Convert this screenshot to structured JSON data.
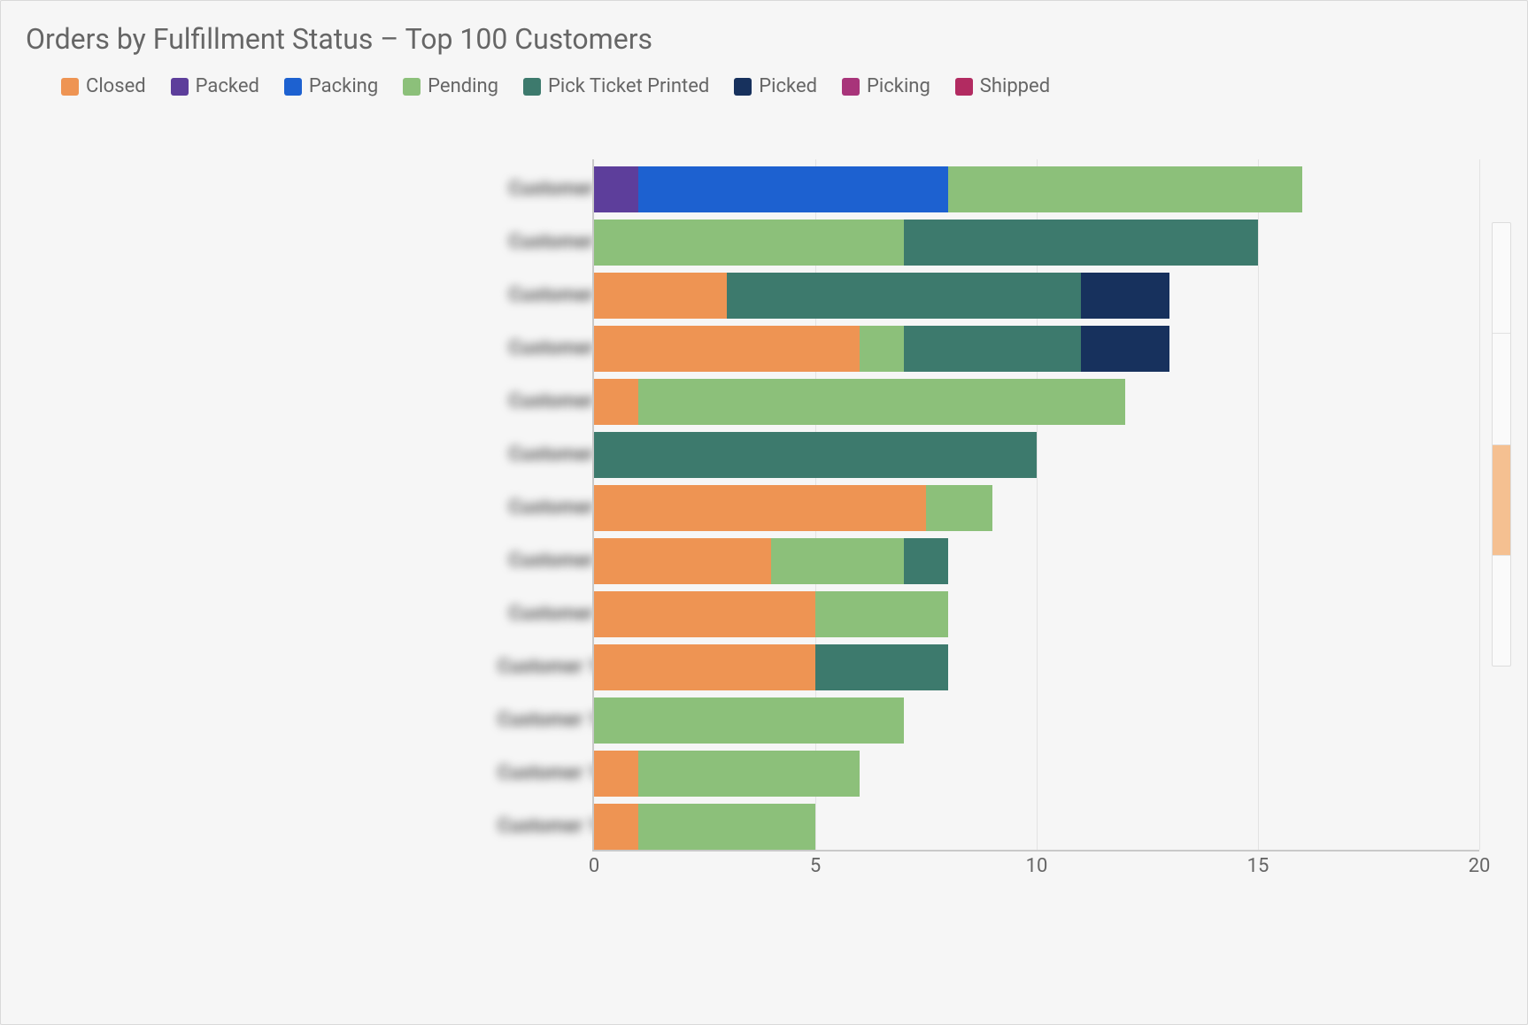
{
  "title": "Orders by Fulfillment Status – Top 100 Customers",
  "legend": [
    {
      "name": "Closed",
      "color": "#ee9453"
    },
    {
      "name": "Packed",
      "color": "#5d3e9b"
    },
    {
      "name": "Packing",
      "color": "#1d61d0"
    },
    {
      "name": "Pending",
      "color": "#8cc07a"
    },
    {
      "name": "Pick Ticket Printed",
      "color": "#3d7a6d"
    },
    {
      "name": "Picked",
      "color": "#17315d"
    },
    {
      "name": "Picking",
      "color": "#a8347a"
    },
    {
      "name": "Shipped",
      "color": "#b22b61"
    }
  ],
  "xticks": [
    "0",
    "5",
    "10",
    "15",
    "20"
  ],
  "x_max": 20,
  "chart_data": {
    "type": "bar",
    "title": "Orders by Fulfillment Status – Top 100 Customers",
    "xlabel": "",
    "ylabel": "",
    "xlim": [
      0,
      20
    ],
    "orientation": "horizontal",
    "stacked": true,
    "categories": [
      "Customer 1",
      "Customer 2",
      "Customer 3",
      "Customer 4",
      "Customer 5",
      "Customer 6",
      "Customer 7",
      "Customer 8",
      "Customer 9",
      "Customer 10",
      "Customer 11",
      "Customer 12",
      "Customer 13"
    ],
    "series": [
      {
        "name": "Closed",
        "values": [
          0.0,
          0.0,
          3.0,
          6.0,
          1.0,
          0.0,
          7.5,
          4.0,
          5.0,
          5.0,
          0.0,
          1.0,
          1.0
        ]
      },
      {
        "name": "Packed",
        "values": [
          1.0,
          0.0,
          0.0,
          0.0,
          0.0,
          0.0,
          0.0,
          0.0,
          0.0,
          0.0,
          0.0,
          0.0,
          0.0
        ]
      },
      {
        "name": "Packing",
        "values": [
          7.0,
          0.0,
          0.0,
          0.0,
          0.0,
          0.0,
          0.0,
          0.0,
          0.0,
          0.0,
          0.0,
          0.0,
          0.0
        ]
      },
      {
        "name": "Pending",
        "values": [
          8.0,
          7.0,
          0.0,
          1.0,
          11.0,
          0.0,
          1.5,
          3.0,
          3.0,
          0.0,
          7.0,
          5.0,
          4.0
        ]
      },
      {
        "name": "Pick Ticket Printed",
        "values": [
          0.0,
          8.0,
          8.0,
          4.0,
          0.0,
          10.0,
          0.0,
          1.0,
          0.0,
          3.0,
          0.0,
          0.0,
          0.0
        ]
      },
      {
        "name": "Picked",
        "values": [
          0.0,
          0.0,
          2.0,
          2.0,
          0.0,
          0.0,
          0.0,
          0.0,
          0.0,
          0.0,
          0.0,
          0.0,
          0.0
        ]
      },
      {
        "name": "Picking",
        "values": [
          0.0,
          0.0,
          0.0,
          0.0,
          0.0,
          0.0,
          0.0,
          0.0,
          0.0,
          0.0,
          0.0,
          0.0,
          0.0
        ]
      },
      {
        "name": "Shipped",
        "values": [
          0.0,
          0.0,
          0.0,
          0.0,
          0.0,
          0.0,
          0.0,
          0.0,
          0.0,
          0.0,
          0.0,
          0.0,
          0.0
        ]
      }
    ]
  }
}
